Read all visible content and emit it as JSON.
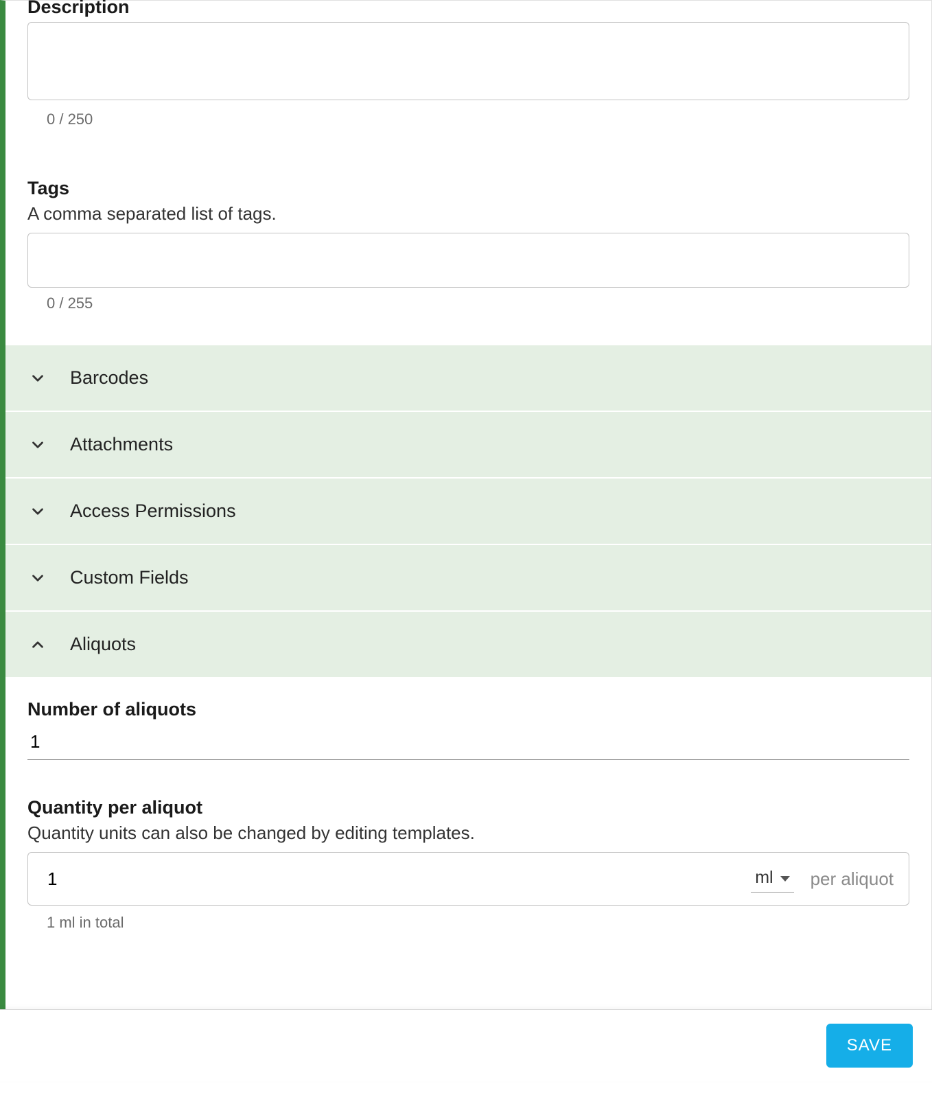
{
  "description": {
    "label": "Description",
    "value": "",
    "counter": "0 / 250"
  },
  "tags": {
    "label": "Tags",
    "desc": "A comma separated list of tags.",
    "value": "",
    "counter": "0 / 255"
  },
  "accordion": {
    "barcodes": "Barcodes",
    "attachments": "Attachments",
    "access_permissions": "Access Permissions",
    "custom_fields": "Custom Fields",
    "aliquots": "Aliquots"
  },
  "aliquots": {
    "num_label": "Number of aliquots",
    "num_value": "1",
    "qty_label": "Quantity per aliquot",
    "qty_desc": "Quantity units can also be changed by editing templates.",
    "qty_value": "1",
    "unit": "ml",
    "per_label": "per aliquot",
    "total_text": "1 ml in total"
  },
  "actions": {
    "save": "SAVE"
  }
}
